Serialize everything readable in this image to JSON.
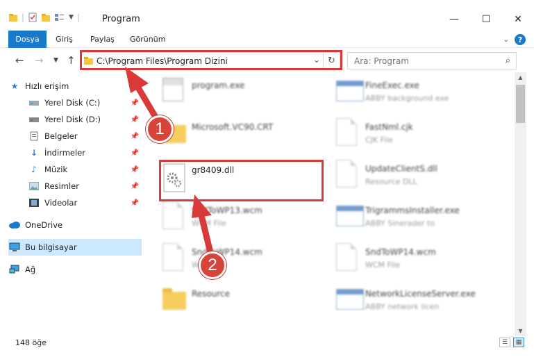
{
  "window": {
    "title": "Program",
    "minimize_icon": "minimize-icon",
    "maximize_icon": "maximize-icon",
    "close_icon": "close-icon"
  },
  "ribbon": {
    "tabs": [
      {
        "label": "Dosya"
      },
      {
        "label": "Giriş"
      },
      {
        "label": "Paylaş"
      },
      {
        "label": "Görünüm"
      }
    ],
    "help": "?"
  },
  "nav": {
    "address": "C:\\Program Files\\Program Dizini",
    "search_placeholder": "Ara: Program"
  },
  "sidebar": {
    "items": [
      {
        "label": "Hızlı erişim",
        "icon": "star-icon"
      },
      {
        "label": "Yerel Disk (C:)",
        "icon": "drive-icon"
      },
      {
        "label": "Yerel Disk (D:)",
        "icon": "drive-icon"
      },
      {
        "label": "Belgeler",
        "icon": "documents-icon"
      },
      {
        "label": "İndirmeler",
        "icon": "download-icon"
      },
      {
        "label": "Müzik",
        "icon": "music-icon"
      },
      {
        "label": "Resimler",
        "icon": "pictures-icon"
      },
      {
        "label": "Videolar",
        "icon": "videos-icon"
      },
      {
        "label": "OneDrive",
        "icon": "cloud-icon"
      },
      {
        "label": "Bu bilgisayar",
        "icon": "computer-icon"
      },
      {
        "label": "Ağ",
        "icon": "network-icon"
      }
    ]
  },
  "files": [
    {
      "name": "program.exe",
      "sub": ""
    },
    {
      "name": "FineExec.exe",
      "sub": "ABBY background exe"
    },
    {
      "name": "Microsoft.VC90.CRT",
      "sub": ""
    },
    {
      "name": "FastNml.cjk",
      "sub": "CJK File"
    },
    {
      "name": "gr8409.dll",
      "sub": ""
    },
    {
      "name": "UpdateClientS.dll",
      "sub": "Resource DLL"
    },
    {
      "name": "SndToWP13.wcm",
      "sub": "WCM File"
    },
    {
      "name": "TrigrammsInstaller.exe",
      "sub": "ABBY Sinerader to"
    },
    {
      "name": "SndToWP14.wcm",
      "sub": "WCM File"
    },
    {
      "name": "SndToWP14.wcm",
      "sub": "WCM File"
    },
    {
      "name": "Resource",
      "sub": ""
    },
    {
      "name": "NetworkLicenseServer.exe",
      "sub": "ABBY network licen"
    }
  ],
  "callouts": {
    "one": "1",
    "two": "2"
  },
  "status": {
    "count": "148 öğe"
  },
  "colors": {
    "accent": "#1979ca",
    "highlight": "#d83a3a",
    "selected": "#cce8ff"
  }
}
